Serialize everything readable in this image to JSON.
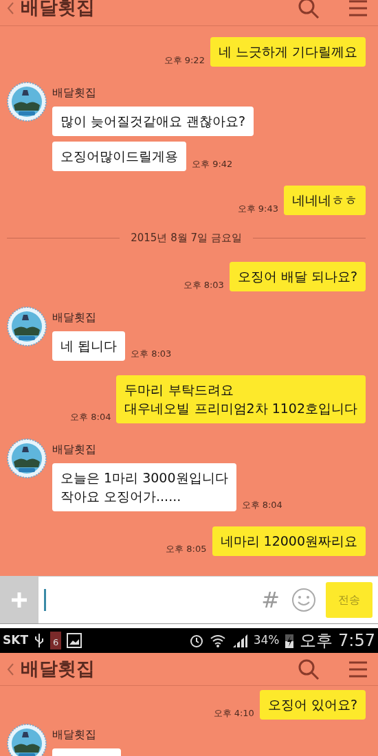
{
  "top_chat": {
    "header": {
      "title": "배달횟집"
    },
    "items": [
      {
        "kind": "sent",
        "text": "네 느긋하게 기다릴께요",
        "time": "오후 9:22"
      },
      {
        "kind": "received",
        "sender": "배달횟집",
        "bubbles": [
          "많이 늦어질것같애요 괜찮아요?",
          "오징어많이드릴게용"
        ],
        "time": "오후 9:42"
      },
      {
        "kind": "sent",
        "text": "네네네ㅎㅎ",
        "time": "오후 9:43"
      },
      {
        "kind": "date",
        "text": "2015년 8월 7일 금요일"
      },
      {
        "kind": "sent",
        "text": "오징어 배달 되나요?",
        "time": "오후 8:03"
      },
      {
        "kind": "received",
        "sender": "배달횟집",
        "bubbles": [
          "네 됩니다"
        ],
        "time": "오후 8:03"
      },
      {
        "kind": "sent",
        "text": "두마리 부탁드려요\n대우네오빌 프리미엄2차 1102호입니다",
        "time": "오후 8:04"
      },
      {
        "kind": "received",
        "sender": "배달횟집",
        "bubbles": [
          "오늘은 1마리 3000원입니다\n작아요 오징어가......"
        ],
        "time": "오후 8:04"
      },
      {
        "kind": "sent",
        "text": "네마리 12000원짜리요",
        "time": "오후 8:05"
      }
    ]
  },
  "input_bar": {
    "send": "전송",
    "hash": "#"
  },
  "status_bar": {
    "carrier": "SKT",
    "badge": "6",
    "battery": "34%",
    "time": "오후 7:57"
  },
  "bottom_chat": {
    "header": {
      "title": "배달횟집"
    },
    "items": [
      {
        "kind": "sent",
        "text": "오징어 있어요?",
        "time": "오후 4:10"
      },
      {
        "kind": "received",
        "sender": "배달횟집"
      }
    ]
  }
}
